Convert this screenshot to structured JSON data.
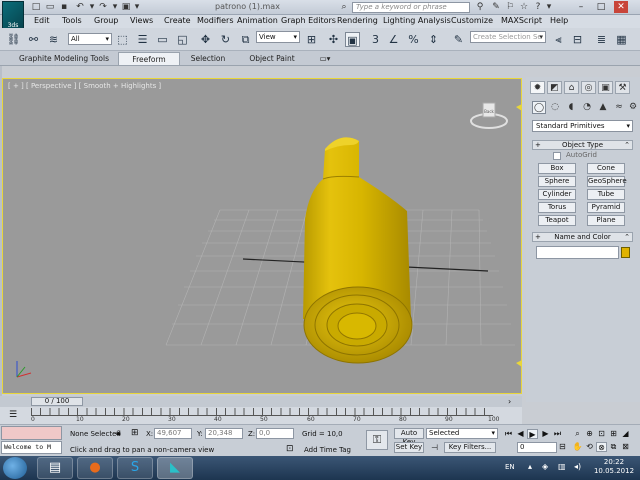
{
  "title_bar": {
    "app_logo_label": "3ds",
    "document_title": "patrono (1).max",
    "search_placeholder": "Type a keyword or phrase"
  },
  "menu": [
    "Edit",
    "Tools",
    "Group",
    "Views",
    "Create",
    "Modifiers",
    "Animation",
    "Graph Editors",
    "Rendering",
    "Lighting Analysis",
    "Customize",
    "MAXScript",
    "Help"
  ],
  "toolbar": {
    "selection_filter": "All",
    "reference_coord": "View",
    "named_selection_placeholder": "Create Selection Se"
  },
  "ribbon_tabs": [
    "Graphite Modeling Tools",
    "Freeform",
    "Selection",
    "Object Paint"
  ],
  "active_ribbon_tab": "Freeform",
  "viewport": {
    "label": "[ + ] [ Perspective ] [ Smooth + Highlights ]",
    "viewcube_label": "Back",
    "object_color": "#d4b800"
  },
  "command_panel": {
    "category": "Standard Primitives",
    "object_type_title": "Object Type",
    "autogrid_label": "AutoGrid",
    "primitives": [
      "Box",
      "Cone",
      "Sphere",
      "GeoSphere",
      "Cylinder",
      "Tube",
      "Torus",
      "Pyramid",
      "Teapot",
      "Plane"
    ],
    "name_color_title": "Name and Color",
    "object_name": "",
    "swatch_color": "#e0b300"
  },
  "timeline": {
    "slider_label": "0 / 100",
    "ticks": [
      "0",
      "10",
      "20",
      "30",
      "40",
      "50",
      "60",
      "70",
      "80",
      "90",
      "100"
    ]
  },
  "status": {
    "script_listener": "Welcome to M",
    "selection_status": "None Selected",
    "x_label": "X:",
    "x_value": "49,607",
    "y_label": "Y:",
    "y_value": "20,348",
    "z_label": "Z:",
    "z_value": "0,0",
    "grid": "Grid = 10,0",
    "prompt": "Click and drag to pan a non-camera view",
    "add_time_tag": "Add Time Tag",
    "auto_key": "Auto Key",
    "set_key": "Set Key",
    "key_mode": "Selected",
    "key_filters": "Key Filters...",
    "current_frame": "0"
  },
  "taskbar": {
    "language": "EN",
    "time": "20:22",
    "date": "10.05.2012"
  }
}
